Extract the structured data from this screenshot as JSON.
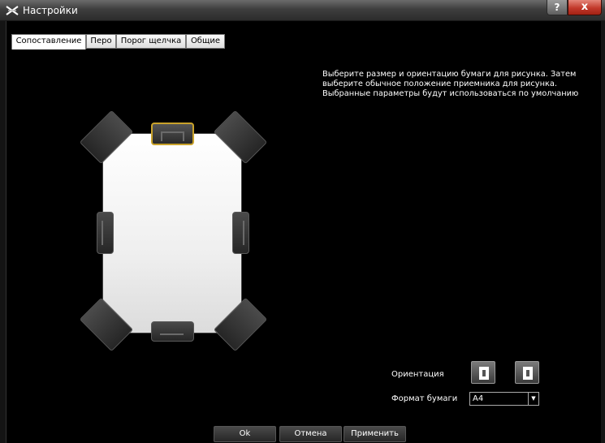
{
  "window": {
    "title": "Настройки",
    "help_label": "?",
    "close_label": "x"
  },
  "tabs": [
    {
      "label": "Сопоставление",
      "active": true
    },
    {
      "label": "Перо",
      "active": false
    },
    {
      "label": "Порог щелчка",
      "active": false
    },
    {
      "label": "Общие",
      "active": false
    }
  ],
  "main": {
    "description": "Выберите размер и ориентацию бумаги для рисунка. Затем выберите обычное положение приемника для рисунка. Выбранные параметры будут использоваться по умолчанию",
    "orientation_label": "Ориентация",
    "paper_format_label": "Формат бумаги",
    "paper_format_value": "A4"
  },
  "buttons": {
    "ok": "Ok",
    "cancel": "Отмена",
    "apply": "Применить"
  },
  "colors": {
    "selected_receiver": "#c9a22a",
    "close_button": "#c2392b"
  },
  "icons": {
    "app": "pen-tablet-icon",
    "orientation_portrait": "portrait-icon",
    "orientation_portrait_alt": "portrait-icon",
    "dropdown": "chevron-down-icon"
  }
}
